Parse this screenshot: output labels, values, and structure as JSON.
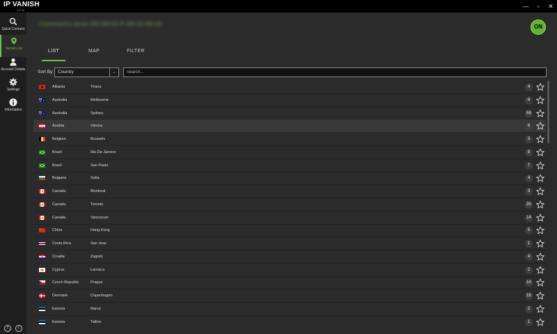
{
  "app": {
    "logo_top": "IP VANISH",
    "logo_bottom": "VPN"
  },
  "window": {
    "minimize": "—",
    "maximize": "▫",
    "close": "✕"
  },
  "sidebar": {
    "items": [
      {
        "label": "Quick Connect",
        "icon": "search-icon"
      },
      {
        "label": "Server List",
        "icon": "location-pin-icon",
        "active": true
      },
      {
        "label": "Account Details",
        "icon": "user-icon"
      },
      {
        "label": "Settings",
        "icon": "gear-icon"
      },
      {
        "label": "Information",
        "icon": "info-icon"
      }
    ],
    "social": {
      "facebook": "f",
      "twitter": "t"
    }
  },
  "status": {
    "blurred_text": "Connected to server 000.000.00 IP 000.00.000.00",
    "power_label": "ON",
    "accent": "#6cc24a"
  },
  "tabs": [
    {
      "label": "LIST",
      "active": true
    },
    {
      "label": "MAP"
    },
    {
      "label": "FILTER"
    }
  ],
  "sort": {
    "label": "Sort By:",
    "value": "Country"
  },
  "search": {
    "placeholder": "Search..."
  },
  "servers": [
    {
      "country": "Albania",
      "city": "Tirana",
      "count": "4",
      "flag": "albania"
    },
    {
      "country": "Australia",
      "city": "Melbourne",
      "count": "8",
      "flag": "australia"
    },
    {
      "country": "Australia",
      "city": "Sydney",
      "count": "59",
      "flag": "australia"
    },
    {
      "country": "Austria",
      "city": "Vienna",
      "count": "6",
      "flag": "austria",
      "highlight": true
    },
    {
      "country": "Belgium",
      "city": "Brussels",
      "count": "3",
      "flag": "belgium"
    },
    {
      "country": "Brazil",
      "city": "Rio De Janeiro",
      "count": "8",
      "flag": "brazil"
    },
    {
      "country": "Brazil",
      "city": "Sao Paulo",
      "count": "7",
      "flag": "brazil"
    },
    {
      "country": "Bulgaria",
      "city": "Sofia",
      "count": "4",
      "flag": "bulgaria"
    },
    {
      "country": "Canada",
      "city": "Montreal",
      "count": "3",
      "flag": "canada"
    },
    {
      "country": "Canada",
      "city": "Toronto",
      "count": "20",
      "flag": "canada"
    },
    {
      "country": "Canada",
      "city": "Vancouver",
      "count": "14",
      "flag": "canada"
    },
    {
      "country": "China",
      "city": "Hong Kong",
      "count": "5",
      "flag": "china"
    },
    {
      "country": "Costa Rica",
      "city": "San Jose",
      "count": "1",
      "flag": "costa-rica"
    },
    {
      "country": "Croatia",
      "city": "Zagreb",
      "count": "4",
      "flag": "croatia"
    },
    {
      "country": "Cyprus",
      "city": "Larnaca",
      "count": "2",
      "flag": "cyprus"
    },
    {
      "country": "Czech Republic",
      "city": "Prague",
      "count": "14",
      "flag": "czech"
    },
    {
      "country": "Denmark",
      "city": "Copenhagen",
      "count": "18",
      "flag": "denmark"
    },
    {
      "country": "Estonia",
      "city": "Narva",
      "count": "2",
      "flag": "estonia"
    },
    {
      "country": "Estonia",
      "city": "Tallinn",
      "count": "1",
      "flag": "estonia"
    }
  ]
}
